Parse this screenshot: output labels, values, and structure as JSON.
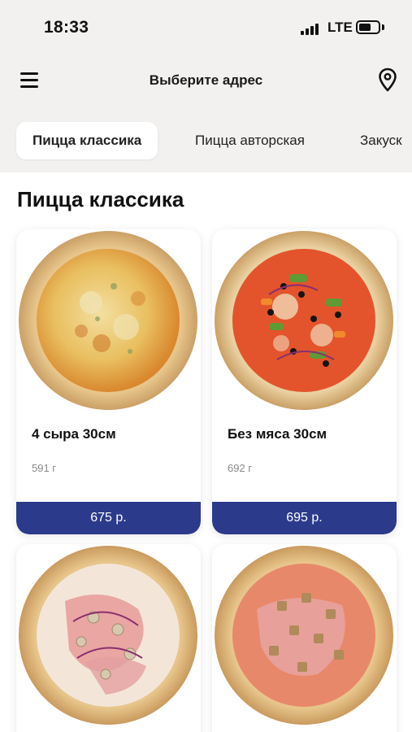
{
  "status_bar": {
    "time": "18:33",
    "network": "LTE"
  },
  "header": {
    "title": "Выберите адрес"
  },
  "tabs": [
    {
      "label": "Пицца классика",
      "active": true
    },
    {
      "label": "Пицца авторская",
      "active": false
    },
    {
      "label": "Закуск",
      "active": false
    }
  ],
  "section": {
    "title": "Пицца классика"
  },
  "products": [
    {
      "name": "4 сыра 30см",
      "weight": "591 г",
      "price": "675 р."
    },
    {
      "name": "Без мяса 30см",
      "weight": "692 г",
      "price": "695 р."
    },
    {
      "name": "",
      "weight": "",
      "price": ""
    },
    {
      "name": "",
      "weight": "",
      "price": ""
    }
  ],
  "colors": {
    "accent": "#2c3a8c",
    "top_background": "#f2f1ef",
    "page_background": "#ffffff"
  },
  "icons": {
    "menu": "hamburger-menu-icon",
    "location": "map-pin-icon"
  }
}
